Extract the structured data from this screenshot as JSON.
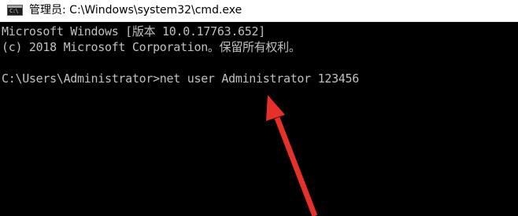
{
  "window": {
    "title": "管理员: C:\\Windows\\system32\\cmd.exe",
    "icon": "cmd-console-icon",
    "icon_text": "C:\\"
  },
  "console": {
    "lines": [
      "Microsoft Windows [版本 10.0.17763.652]",
      "(c) 2018 Microsoft Corporation。保留所有权利。",
      "C:\\Users\\Administrator>net user Administrator 123456"
    ]
  },
  "annotation": {
    "type": "red-arrow",
    "color": "#e8302a",
    "points_to": "123456"
  },
  "colors": {
    "titlebar_bg": "#ffffff",
    "console_bg": "#000000",
    "console_text": "#c0c0c0",
    "arrow": "#e8302a"
  }
}
